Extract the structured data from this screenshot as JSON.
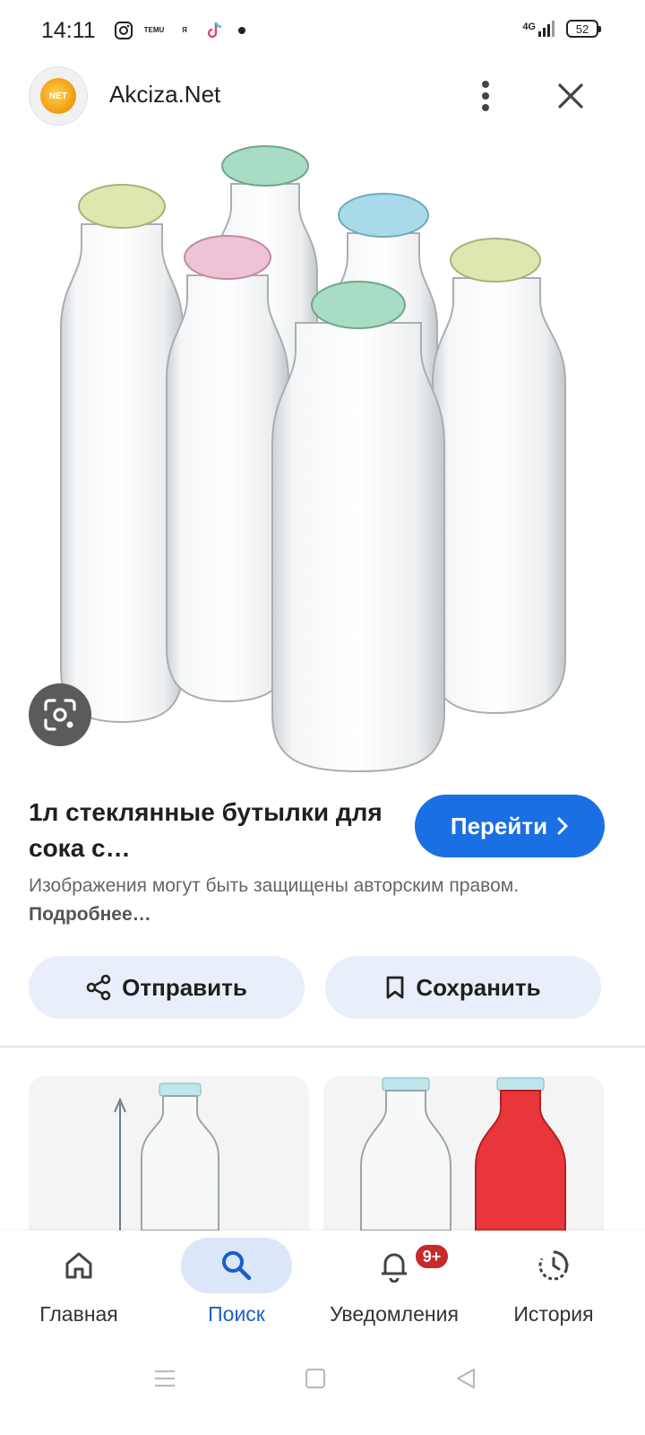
{
  "status_bar": {
    "time": "14:11",
    "notification_icons": [
      "instagram-icon",
      "temu-icon",
      "yandex-market-icon",
      "tiktok-icon",
      "more-notifications-dot"
    ],
    "temu_text": "TEMU",
    "market_text": "Я",
    "network": "4G",
    "battery": "52"
  },
  "header": {
    "site_name": "Akciza.Net",
    "logo_text": "NET"
  },
  "result": {
    "title": "1л стеклянные бутылки для сока с…",
    "visit_label": "Перейти",
    "copyright_text": "Изображения могут быть защищены авторским правом.",
    "more_link": "Подробнее…"
  },
  "actions": {
    "share_label": "Отправить",
    "save_label": "Сохранить"
  },
  "bottom_nav": {
    "items": [
      {
        "label": "Главная",
        "icon": "home-icon"
      },
      {
        "label": "Поиск",
        "icon": "search-icon"
      },
      {
        "label": "Уведомления",
        "icon": "bell-icon",
        "badge": "9+"
      },
      {
        "label": "История",
        "icon": "history-icon"
      }
    ],
    "active": "Поиск"
  },
  "colors": {
    "accent": "#1a6fe3",
    "chip_bg": "#e8effa",
    "badge": "#c62a2a",
    "active_nav": "#dbe6f8"
  }
}
